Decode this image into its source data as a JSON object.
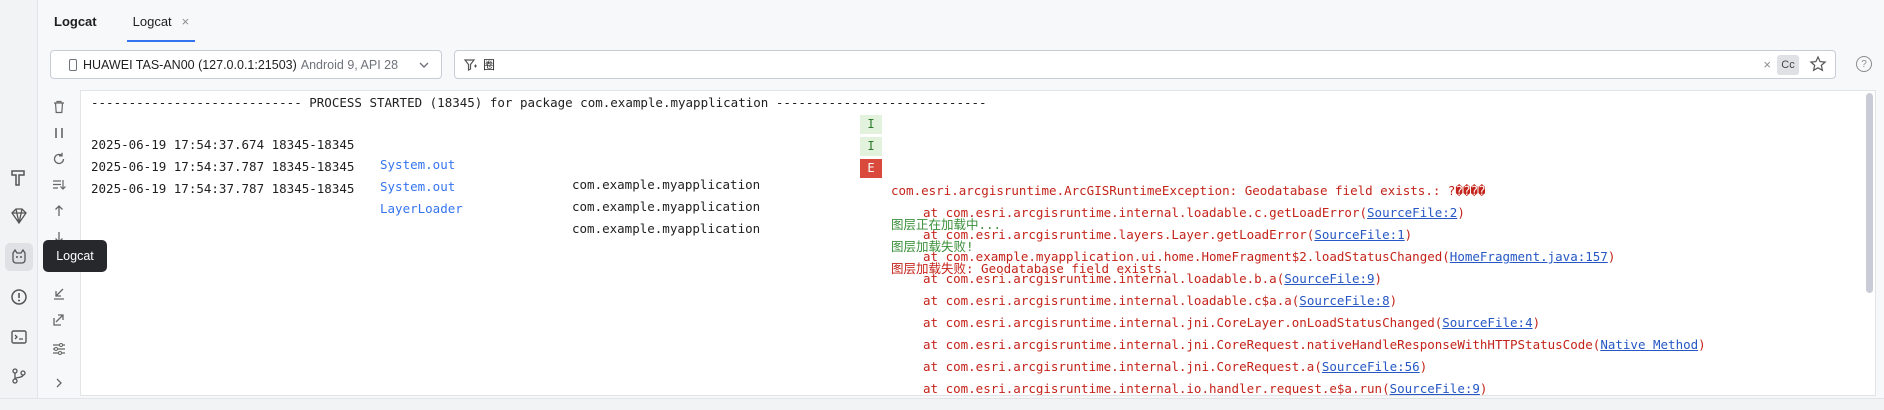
{
  "tab_bar": {
    "title": "Logcat",
    "tab_label": "Logcat",
    "tab_close": "×"
  },
  "device": {
    "name": "HUAWEI TAS-AN00 (127.0.0.1:21503)",
    "details": "Android 9, API 28"
  },
  "filter": {
    "value": "圈",
    "clear": "×",
    "case_label": "Cc"
  },
  "help": "?",
  "tooltip": "Logcat",
  "log": {
    "header": "---------------------------- PROCESS STARTED (18345) for package com.example.myapplication ----------------------------",
    "entries": [
      {
        "time": "2025-06-19 17:54:37.674 18345-18345",
        "tag": "System.out",
        "package": "com.example.myapplication",
        "level": "I",
        "message": "图层正在加载中..."
      },
      {
        "time": "2025-06-19 17:54:37.787 18345-18345",
        "tag": "System.out",
        "package": "com.example.myapplication",
        "level": "I",
        "message": "图层加载失败!"
      },
      {
        "time": "2025-06-19 17:54:37.787 18345-18345",
        "tag": "LayerLoader",
        "package": "com.example.myapplication",
        "level": "E",
        "message": "图层加载失败: Geodatabase field exists."
      }
    ],
    "exception": "com.esri.arcgisruntime.ArcGISRuntimeException: Geodatabase field exists.: ?����",
    "stack": [
      {
        "prefix": "at com.esri.arcgisruntime.internal.loadable.c.getLoadError(",
        "link": "SourceFile:2",
        "suffix": ")"
      },
      {
        "prefix": "at com.esri.arcgisruntime.layers.Layer.getLoadError(",
        "link": "SourceFile:1",
        "suffix": ")"
      },
      {
        "prefix": "at com.example.myapplication.ui.home.HomeFragment$2.loadStatusChanged(",
        "link": "HomeFragment.java:157",
        "suffix": ")"
      },
      {
        "prefix": "at com.esri.arcgisruntime.internal.loadable.b.a(",
        "link": "SourceFile:9",
        "suffix": ")"
      },
      {
        "prefix": "at com.esri.arcgisruntime.internal.loadable.c$a.a(",
        "link": "SourceFile:8",
        "suffix": ")"
      },
      {
        "prefix": "at com.esri.arcgisruntime.internal.jni.CoreLayer.onLoadStatusChanged(",
        "link": "SourceFile:4",
        "suffix": ")"
      },
      {
        "prefix": "at com.esri.arcgisruntime.internal.jni.CoreRequest.nativeHandleResponseWithHTTPStatusCode(",
        "link": "Native Method",
        "suffix": ")"
      },
      {
        "prefix": "at com.esri.arcgisruntime.internal.jni.CoreRequest.a(",
        "link": "SourceFile:56",
        "suffix": ")"
      },
      {
        "prefix": "at com.esri.arcgisruntime.internal.io.handler.request.e$a.run(",
        "link": "SourceFile:9",
        "suffix": ")"
      }
    ]
  },
  "icons": {
    "strip": [
      "build-icon",
      "gem-icon",
      "logcat-icon",
      "problems-icon",
      "terminal-icon",
      "git-icon"
    ],
    "log_tools": [
      "clear-log-icon",
      "pause-icon",
      "restart-icon",
      "scroll-to-end-icon",
      "scroll-up-icon",
      "scroll-down-icon",
      "import-icon",
      "export-icon",
      "settings-sliders-icon",
      "expand-icon"
    ]
  },
  "colors": {
    "accent": "#3574f0",
    "error": "#c4231a",
    "info": "#3a8f3a",
    "error_badge": "#d94a3d",
    "info_badge": "#e2f2dd",
    "link": "#2657c4"
  }
}
